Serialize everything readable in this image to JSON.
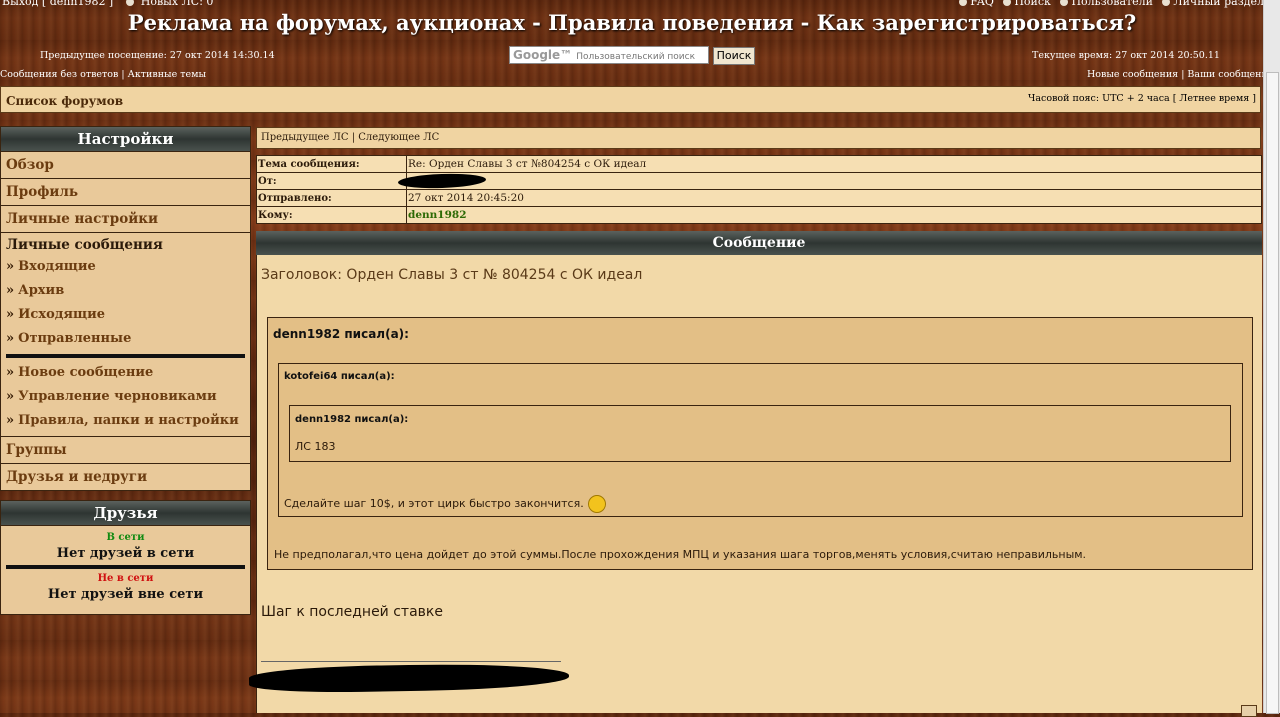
{
  "topbar": {
    "left_text": "Выход [ denn1982 ]",
    "new_pm": "Новых ЛС: 0",
    "links": [
      "FAQ",
      "Поиск",
      "Пользователи",
      "Личный раздел"
    ]
  },
  "site_title": "Реклама на форумах, аукционах - Правила поведения - Как зарегистрироваться?",
  "prev_visit": "Предыдущее посещение: 27 окт 2014 14:30.14",
  "current_time": "Текущее время: 27 окт 2014 20:50.11",
  "search": {
    "brand": "Google™",
    "placeholder": "Пользовательский поиск",
    "button": "Поиск"
  },
  "nav_left": {
    "unanswered": "Сообщения без ответов",
    "sep": "|",
    "active": "Активные темы"
  },
  "nav_right": {
    "new_posts": "Новые сообщения",
    "sep": "|",
    "your_posts": "Ваши сообщения"
  },
  "forum_index": "Список форумов",
  "timezone": "Часовой пояс: UTC + 2 часа [ Летнее время ]",
  "settings": {
    "title": "Настройки",
    "items": [
      "Обзор",
      "Профиль",
      "Личные настройки"
    ],
    "pm": {
      "title": "Личные сообщения",
      "folders": [
        "Входящие",
        "Архив",
        "Исходящие",
        "Отправленные"
      ],
      "actions": [
        "Новое сообщение",
        "Управление черновиками",
        "Правила, папки и настройки"
      ]
    },
    "bottom": [
      "Группы",
      "Друзья и недруги"
    ]
  },
  "friends": {
    "title": "Друзья",
    "online_label": "В сети",
    "online_empty": "Нет друзей в сети",
    "offline_label": "Не в сети",
    "offline_empty": "Нет друзей вне сети"
  },
  "pager": {
    "prev": "Предыдущее ЛС",
    "sep": "|",
    "next": "Следующее ЛС"
  },
  "header_fields": {
    "subject_k": "Тема сообщения:",
    "subject_v": "Re: Орден Славы 3 ст №804254 с ОК идеал",
    "from_k": "От:",
    "sent_k": "Отправлено:",
    "sent_v": "27 окт 2014 20:45:20",
    "to_k": "Кому:",
    "to_v": "denn1982"
  },
  "message": {
    "title": "Сообщение",
    "subject": "Заголовок: Орден Славы 3 ст № 804254 с ОК идеал",
    "q1_author": "denn1982 писал(а):",
    "q2_author": "kotofei64 писал(а):",
    "q3_author": "denn1982 писал(а):",
    "q3_text": "ЛС 183",
    "q2_text": "Сделайте шаг 10$, и этот цирк быстро закончится.",
    "q1_text": "Не предполагал,что цена дойдет до этой суммы.После прохождения МПЦ и указания шага торгов,менять условия,считаю неправильным.",
    "body": "Шаг к последней ставке"
  }
}
